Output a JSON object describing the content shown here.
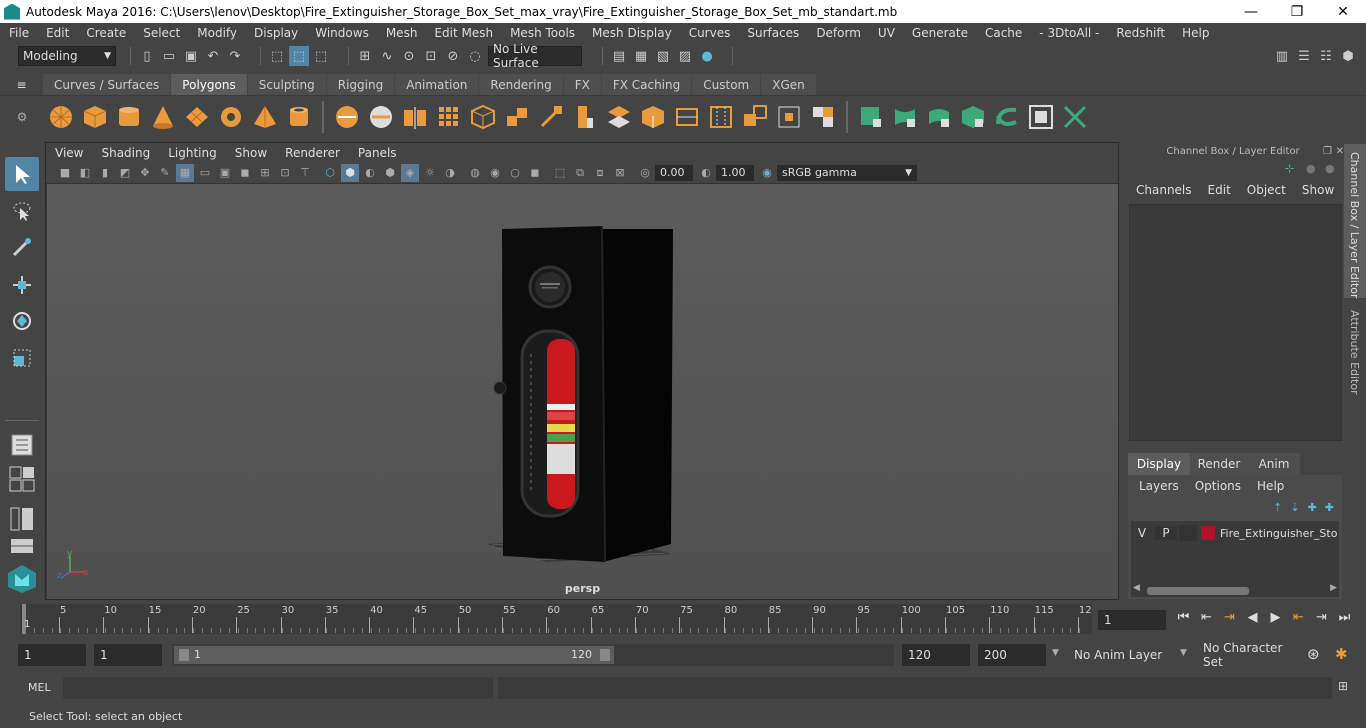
{
  "window": {
    "title": "Autodesk Maya 2016: C:\\Users\\lenov\\Desktop\\Fire_Extinguisher_Storage_Box_Set_max_vray\\Fire_Extinguisher_Storage_Box_Set_mb_standart.mb",
    "minimize": "—",
    "maximize": "❐",
    "close": "✕"
  },
  "menu": [
    "File",
    "Edit",
    "Create",
    "Select",
    "Modify",
    "Display",
    "Windows",
    "Mesh",
    "Edit Mesh",
    "Mesh Tools",
    "Mesh Display",
    "Curves",
    "Surfaces",
    "Deform",
    "UV",
    "Generate",
    "Cache",
    "- 3DtoAll -",
    "Redshift",
    "Help"
  ],
  "status": {
    "mode": "Modeling",
    "live_surface": "No Live Surface"
  },
  "shelf_tabs": [
    "Curves / Surfaces",
    "Polygons",
    "Sculpting",
    "Rigging",
    "Animation",
    "Rendering",
    "FX",
    "FX Caching",
    "Custom",
    "XGen"
  ],
  "shelf_active": "Polygons",
  "panel_menu": [
    "View",
    "Shading",
    "Lighting",
    "Show",
    "Renderer",
    "Panels"
  ],
  "panel_toolbar": {
    "exposure": "0.00",
    "gamma": "1.00",
    "color_space": "sRGB gamma"
  },
  "viewport": {
    "camera_label": "persp",
    "axis_y": "y",
    "axis_x": "x",
    "axis_z": "z"
  },
  "channel_box": {
    "title": "Channel Box / Layer Editor",
    "menu": [
      "Channels",
      "Edit",
      "Object",
      "Show"
    ]
  },
  "layer_editor": {
    "tabs": [
      "Display",
      "Render",
      "Anim"
    ],
    "active_tab": "Display",
    "menu": [
      "Layers",
      "Options",
      "Help"
    ],
    "layer": {
      "v": "V",
      "p": "P",
      "name": "Fire_Extinguisher_Stor",
      "color": "#b0122a"
    }
  },
  "side_tabs": [
    "Channel Box / Layer Editor",
    "Attribute Editor"
  ],
  "timeline": {
    "ticks": [
      "5",
      "10",
      "15",
      "20",
      "25",
      "30",
      "35",
      "40",
      "45",
      "50",
      "55",
      "60",
      "65",
      "70",
      "75",
      "80",
      "85",
      "90",
      "95",
      "100",
      "105",
      "110",
      "115",
      "12"
    ],
    "start_tick": "1",
    "current_frame": "1"
  },
  "range": {
    "start": "1",
    "anim_start": "1",
    "slider_start": "1",
    "slider_end": "120",
    "end": "120",
    "anim_end": "200",
    "anim_layer": "No Anim Layer",
    "character_set": "No Character Set"
  },
  "mel": {
    "label": "MEL"
  },
  "help_line": "Select Tool: select an object"
}
